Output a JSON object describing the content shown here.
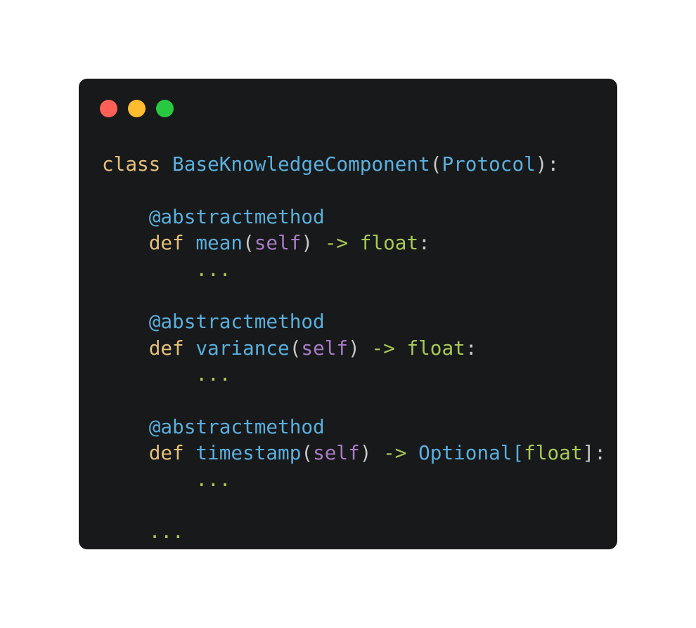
{
  "window": {
    "controls": {
      "close_color": "#fe5f57",
      "minimize_color": "#febc2e",
      "maximize_color": "#28c840"
    }
  },
  "code": {
    "class_kw": "class",
    "class_name": "BaseKnowledgeComponent",
    "paren_open": "(",
    "base_class": "Protocol",
    "class_close": "):",
    "decorator": "@abstractmethod",
    "def_kw": "def",
    "self": "self",
    "arrow": "->",
    "methods": [
      {
        "name": "mean",
        "return_prefix": "",
        "return_type": "float",
        "return_suffix": "",
        "colon": ":"
      },
      {
        "name": "variance",
        "return_prefix": "",
        "return_type": "float",
        "return_suffix": "",
        "colon": ":"
      },
      {
        "name": "timestamp",
        "return_prefix": "Optional[",
        "return_type": "float",
        "return_suffix": "]",
        "colon": ":"
      }
    ],
    "ellipsis": "...",
    "paren_close": ")"
  }
}
